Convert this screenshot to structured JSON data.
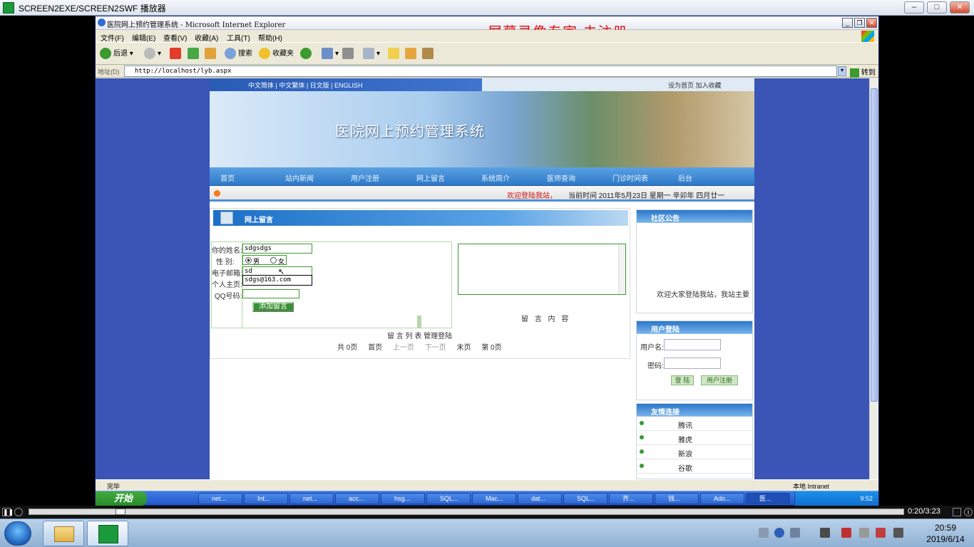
{
  "player": {
    "title": "SCREEN2EXE/SCREEN2SWF 播放器",
    "timecode": "0:20/3:23",
    "progress": 0.1
  },
  "ie": {
    "title": "医院网上预约管理系统 - Microsoft Internet Explorer",
    "watermark": "屏幕录像专家  未注册",
    "menu": [
      "文件(F)",
      "编辑(E)",
      "查看(V)",
      "收藏(A)",
      "工具(T)",
      "帮助(H)"
    ],
    "toolbar": {
      "back": "后退",
      "search": "搜索",
      "favorites": "收藏夹"
    },
    "address_label": "地址(D)",
    "address": "http://localhost/lyb.aspx",
    "go": "转到",
    "status_left": "完毕",
    "status_right": "本地 Intranet"
  },
  "site": {
    "lang_links": "中文简体  |  中文繁体  |  日文版  |  ENGLISH",
    "top_right": "设为首页     加入收藏",
    "banner_title": "医院网上预约管理系统",
    "nav": [
      "首页",
      "站内新闻",
      "用户注册",
      "网上留言",
      "系统简介",
      "医师查询",
      "门诊时间表",
      "后台"
    ],
    "welcome": "欢迎登陆我站，",
    "date_line": "当前时间    2011年5月23日  星期一  辛卯年  四月廿一"
  },
  "guestbook": {
    "header": "网上留言",
    "name_label": "你的姓名:",
    "name_value": "sdgsdgs",
    "gender_label": "性  别:",
    "gender_male": "男",
    "gender_female": "女",
    "email_label": "电子邮箱:",
    "email_value": "sd",
    "autocomplete": "sdgs@163.com",
    "homepage_label": "个人主页:",
    "qq_label": "QQ号码:",
    "submit": "添加留言",
    "content_label": "留 言 内 容",
    "list_label": "留 言 列 表     管理登陆",
    "pager": [
      "共 0页",
      "首页",
      "上一页",
      "下一页",
      "末页",
      "第 0页"
    ]
  },
  "sidebar": {
    "notice_title": "社区公告",
    "notice_text": "欢迎大家登陆我站，我站主要",
    "login_title": "用户登陆",
    "username_label": "用户名:",
    "password_label": "密码:",
    "login_btn": "登 陆",
    "register_btn": "用户注册",
    "links_title": "友情连接",
    "links": [
      "腾讯",
      "雅虎",
      "新浪",
      "谷歌"
    ]
  },
  "xp_taskbar": {
    "start": "开始",
    "tasks": [
      "net...",
      "Int...",
      "net...",
      "acc...",
      "hsg...",
      "SQL...",
      "Mac...",
      "dat...",
      "SQL...",
      "齐...",
      "钱...",
      "Ado...",
      "医..."
    ],
    "clock": "9:52"
  },
  "w7": {
    "time": "20:59",
    "date": "2019/6/14"
  }
}
